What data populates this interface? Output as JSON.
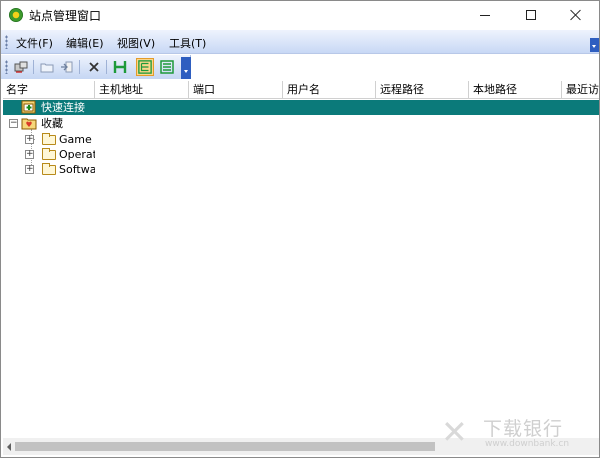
{
  "window": {
    "title": "站点管理窗口"
  },
  "menubar": {
    "items": [
      {
        "label": "文件(F)"
      },
      {
        "label": "编辑(E)"
      },
      {
        "label": "视图(V)"
      },
      {
        "label": "工具(T)"
      }
    ]
  },
  "toolbar": {
    "buttons": [
      {
        "icon": "connect-icon"
      },
      {
        "icon": "new-folder-icon"
      },
      {
        "icon": "import-icon"
      },
      {
        "icon": "delete-icon"
      },
      {
        "icon": "horizontal-layout-icon"
      },
      {
        "icon": "tree-view-icon"
      },
      {
        "icon": "list-view-icon"
      }
    ]
  },
  "columns": [
    {
      "label": "名字"
    },
    {
      "label": "主机地址"
    },
    {
      "label": "端口"
    },
    {
      "label": "用户名"
    },
    {
      "label": "远程路径"
    },
    {
      "label": "本地路径"
    },
    {
      "label": "最近访"
    }
  ],
  "tree": {
    "quick_connect": "快速连接",
    "favorites": "收藏",
    "folders": [
      {
        "label": "Game"
      },
      {
        "label": "Operatin"
      },
      {
        "label": "Softwar"
      }
    ]
  },
  "watermark": {
    "text": "下载银行",
    "url": "www.downbank.cn"
  },
  "colors": {
    "selection": "#0b7a7a",
    "menubar_gradient_top": "#eef3fd",
    "menubar_gradient_bottom": "#c8d8f5",
    "accent_blue": "#2e5ec0"
  }
}
